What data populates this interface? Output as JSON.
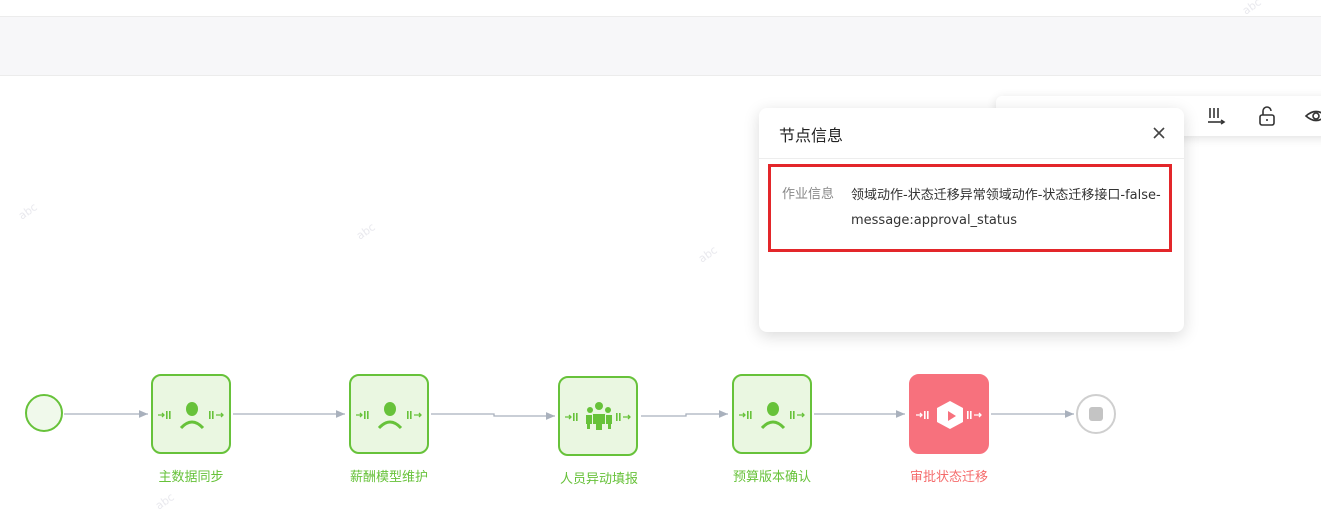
{
  "popup": {
    "title": "节点信息",
    "close_icon": "close-icon",
    "info_label": "作业信息",
    "info_value": "领域动作-状态迁移异常领域动作-状态迁移接口-false-message:approval_status"
  },
  "watermark": "abc",
  "toolbar": {
    "icons": [
      "zoom-icon",
      "zoom-icon",
      "fit-icon",
      "expand-icon",
      "align-icon",
      "unlock-icon",
      "view-icon"
    ]
  },
  "flow": {
    "nodes": [
      {
        "label": "主数据同步",
        "icon": "user-icon",
        "status": "success"
      },
      {
        "label": "薪酬模型维护",
        "icon": "user-icon",
        "status": "success"
      },
      {
        "label": "人员异动填报",
        "icon": "group-icon",
        "status": "success"
      },
      {
        "label": "预算版本确认",
        "icon": "user-icon",
        "status": "success"
      },
      {
        "label": "审批状态迁移",
        "icon": "cube-icon",
        "status": "error"
      }
    ]
  },
  "colors": {
    "success": "#67c23a",
    "error": "#f56c6c",
    "highlight_border": "#e3262a"
  }
}
